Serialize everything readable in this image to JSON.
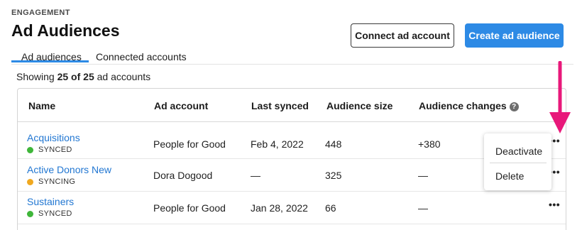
{
  "header": {
    "eyebrow": "ENGAGEMENT",
    "title": "Ad Audiences",
    "connect_button": "Connect ad account",
    "create_button": "Create ad audience"
  },
  "tabs": [
    {
      "label": "Ad audiences",
      "active": true
    },
    {
      "label": "Connected accounts",
      "active": false
    }
  ],
  "summary": {
    "prefix": "Showing",
    "count": "25 of 25",
    "suffix": "ad accounts"
  },
  "table": {
    "columns": {
      "name": "Name",
      "ad_account": "Ad account",
      "last_synced": "Last synced",
      "audience_size": "Audience size",
      "audience_changes": "Audience changes"
    },
    "help_icon": "question-circle-icon",
    "rows": [
      {
        "name": "Acquisitions",
        "status": "SYNCED",
        "status_color": "#3fb63a",
        "ad_account": "People for Good",
        "last_synced": "Feb 4, 2022",
        "audience_size": "448",
        "audience_changes": "+380"
      },
      {
        "name": "Active Donors New",
        "status": "SYNCING",
        "status_color": "#f0a81f",
        "ad_account": "Dora Dogood",
        "last_synced": "—",
        "audience_size": "325",
        "audience_changes": "—"
      },
      {
        "name": "Sustainers",
        "status": "SYNCED",
        "status_color": "#3fb63a",
        "ad_account": "People for Good",
        "last_synced": "Jan 28, 2022",
        "audience_size": "66",
        "audience_changes": "—"
      }
    ],
    "row_menu_glyph": "•••"
  },
  "menu": {
    "items": [
      "Deactivate",
      "Delete"
    ]
  },
  "annotation": {
    "arrow_color": "#e8187a",
    "icon": "arrow-down-icon"
  },
  "colors": {
    "accent": "#2d8ae5",
    "link": "#2277d2"
  }
}
